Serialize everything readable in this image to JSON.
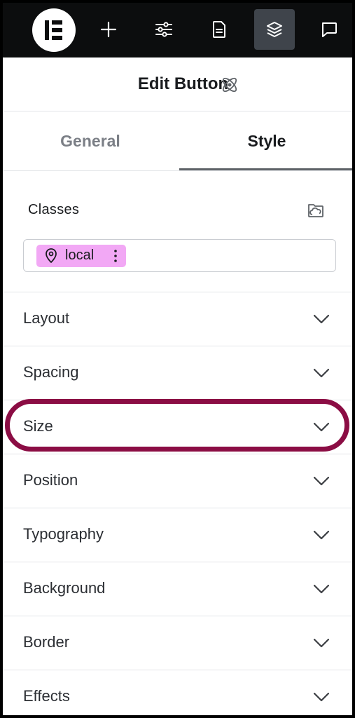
{
  "toolbar": {
    "items": [
      {
        "name": "elementor-logo"
      },
      {
        "name": "plus-icon"
      },
      {
        "name": "sliders-icon"
      },
      {
        "name": "document-icon"
      },
      {
        "name": "layers-icon",
        "active": true
      },
      {
        "name": "chat-icon"
      }
    ]
  },
  "panel": {
    "title": "Edit Button",
    "title_icon": "atom-icon"
  },
  "tabs": [
    {
      "label": "General",
      "active": false
    },
    {
      "label": "Style",
      "active": true
    }
  ],
  "classes": {
    "label": "Classes",
    "action_icon": "cloud-folder-icon",
    "chips": [
      {
        "label": "local",
        "icon": "map-pin-icon",
        "color": "#f2a8f5"
      }
    ]
  },
  "sections": [
    {
      "label": "Layout"
    },
    {
      "label": "Spacing"
    },
    {
      "label": "Size",
      "highlighted": true
    },
    {
      "label": "Position"
    },
    {
      "label": "Typography"
    },
    {
      "label": "Background"
    },
    {
      "label": "Border"
    },
    {
      "label": "Effects"
    }
  ],
  "colors": {
    "topbar_bg": "#0c0d0e",
    "active_toolbar_btn": "#3f444b",
    "chip_bg": "#f2a8f5",
    "highlight_ring": "#8b0d44"
  }
}
